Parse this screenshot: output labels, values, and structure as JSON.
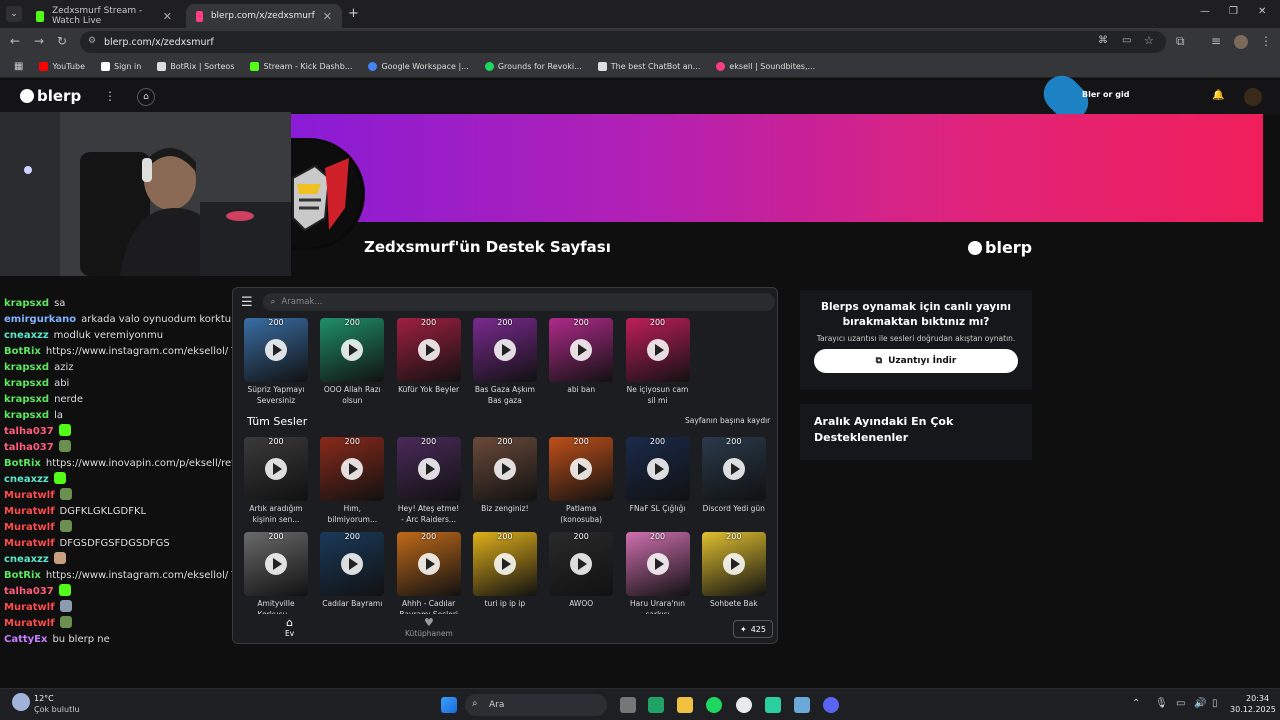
{
  "browser": {
    "tabs": [
      {
        "title": "Zedxsmurf Stream - Watch Live",
        "active": false,
        "color": "#53fc18"
      },
      {
        "title": "blerp.com/x/zedxsmurf",
        "active": true,
        "color": "#ff3d7f"
      }
    ],
    "url": "blerp.com/x/zedxsmurf",
    "bookmarks": [
      {
        "label": "YouTube",
        "color": "#ff0000"
      },
      {
        "label": "Sign in",
        "color": "#ffffff"
      },
      {
        "label": "BotRix | Sorteos",
        "color": "#dddddd"
      },
      {
        "label": "Stream - Kick Dashb...",
        "color": "#53fc18"
      },
      {
        "label": "Google Workspace |...",
        "color": "#4285f4"
      },
      {
        "label": "Grounds for Revoki...",
        "color": "#1ed760"
      },
      {
        "label": "The best ChatBot an...",
        "color": "#dddddd"
      },
      {
        "label": "eksell | Soundbites,...",
        "color": "#ff3d7f"
      }
    ]
  },
  "blerp": {
    "logo": "blerp",
    "page_title": "Zedxsmurf'ün Destek Sayfası",
    "header_right": "Bler   or   gid"
  },
  "chat": [
    {
      "user": "krapsxd",
      "color": "#5ee65e",
      "text": "sa"
    },
    {
      "user": "emirgurkano",
      "color": "#7fb2ff",
      "text": "arkada valo oynuodum korktum"
    },
    {
      "user": "cneaxzz",
      "color": "#5ee6c8",
      "text": "modluk veremiyonmu"
    },
    {
      "user": "BotRix",
      "color": "#5ee65e",
      "text": "https://www.instagram.com/eksellol/ Takip etmeyi unutma"
    },
    {
      "user": "krapsxd",
      "color": "#5ee65e",
      "text": "aziz"
    },
    {
      "user": "krapsxd",
      "color": "#5ee65e",
      "text": "abi"
    },
    {
      "user": "krapsxd",
      "color": "#5ee65e",
      "text": "nerde"
    },
    {
      "user": "krapsxd",
      "color": "#5ee65e",
      "text": "la"
    },
    {
      "user": "talha037",
      "color": "#ff5e7a",
      "text": "",
      "emote": "#53fc18"
    },
    {
      "user": "talha037",
      "color": "#ff5e7a",
      "text": "",
      "emote": "#6b8f4e"
    },
    {
      "user": "BotRix",
      "color": "#5ee65e",
      "text": "https://www.inovapin.com/p/eksell/ref Ucuz Pin için tıkla"
    },
    {
      "user": "cneaxzz",
      "color": "#5ee6c8",
      "text": "",
      "emote": "#53fc18"
    },
    {
      "user": "Muratwlf",
      "color": "#ff4b4b",
      "text": "",
      "emote": "#6b8f4e"
    },
    {
      "user": "Muratwlf",
      "color": "#ff4b4b",
      "text": "DGFKLGKLGDFKL"
    },
    {
      "user": "Muratwlf",
      "color": "#ff4b4b",
      "text": "",
      "emote": "#6b8f4e"
    },
    {
      "user": "Muratwlf",
      "color": "#ff4b4b",
      "text": "DFGSDFGSFDGSDFGS"
    },
    {
      "user": "cneaxzz",
      "color": "#5ee6c8",
      "text": "",
      "emote": "#c8a080"
    },
    {
      "user": "BotRix",
      "color": "#5ee65e",
      "text": "https://www.instagram.com/eksellol/ Takip etmeyi unutma"
    },
    {
      "user": "talha037",
      "color": "#ff5e7a",
      "text": "",
      "emote": "#53fc18"
    },
    {
      "user": "Muratwlf",
      "color": "#ff4b4b",
      "text": "",
      "emote": "#8d9bb0"
    },
    {
      "user": "Muratwlf",
      "color": "#ff4b4b",
      "text": "",
      "emote": "#6b8f4e"
    },
    {
      "user": "CattyEx",
      "color": "#c77dff",
      "text": "bu blerp ne"
    }
  ],
  "panel": {
    "search_placeholder": "Aramak...",
    "section_title": "Tüm Sesler",
    "scroll_top": "Sayfanın başına kaydır",
    "featured": [
      {
        "count": "200",
        "label": "Süpriz Yapmayı Seversiniz",
        "color": "#3a6ea5"
      },
      {
        "count": "200",
        "label": "OOO Allah Razı olsun",
        "color": "#1f8f6a"
      },
      {
        "count": "200",
        "label": "Küfür Yok Beyler",
        "color": "#a02040"
      },
      {
        "count": "200",
        "label": "Bas Gaza Aşkım Bas gaza",
        "color": "#7a2a90"
      },
      {
        "count": "200",
        "label": "abi ban",
        "color": "#b02a8a"
      },
      {
        "count": "200",
        "label": "Ne içiyosun cam sil mi",
        "color": "#c01e5a"
      }
    ],
    "row1": [
      {
        "count": "200",
        "label": "Artık aradığım kişinin sen...",
        "color": "#3a3a3a"
      },
      {
        "count": "200",
        "label": "Hım, bilmiyorum...",
        "color": "#8a2a1a"
      },
      {
        "count": "200",
        "label": "Hey! Ateş etme! - Arc Raiders...",
        "color": "#4a2a5a"
      },
      {
        "count": "200",
        "label": "Biz zenginiz!",
        "color": "#6a4a3a"
      },
      {
        "count": "200",
        "label": "Patlama (konosuba)",
        "color": "#c0501a"
      },
      {
        "count": "200",
        "label": "FNaF SL Çığlığı",
        "color": "#1a2a4a"
      },
      {
        "count": "200",
        "label": "Discord Yedi gün",
        "color": "#2a3a4a"
      }
    ],
    "row2": [
      {
        "count": "200",
        "label": "Amityville Korkusu...",
        "color": "#6a6a6a"
      },
      {
        "count": "200",
        "label": "Cadılar Bayramı",
        "color": "#1a3a5a"
      },
      {
        "count": "200",
        "label": "Ahhh - Cadılar Bayramı Sesleri",
        "color": "#c06a1a"
      },
      {
        "count": "200",
        "label": "turi ip ip ip",
        "color": "#e0b01a"
      },
      {
        "count": "200",
        "label": "AWOO",
        "color": "#2a2a2a"
      },
      {
        "count": "200",
        "label": "Haru Urara'nın şarkısı",
        "color": "#d070b0"
      },
      {
        "count": "200",
        "label": "Sohbete Bak",
        "color": "#e0c030"
      }
    ],
    "nav_home": "Ev",
    "nav_library": "Kütüphanem",
    "coins": "425"
  },
  "promo": {
    "heading": "Blerps oynamak için canlı yayını bırakmaktan bıktınız mı?",
    "sub": "Tarayıcı uzantısı ile sesleri doğrudan akıştan oynatın.",
    "button": "Uzantıyı İndir"
  },
  "top_supporters": "Aralık Ayındaki En Çok Desteklenenler",
  "taskbar": {
    "weather_temp": "12°C",
    "weather_desc": "Çok bulutlu",
    "search": "Ara",
    "time": "20:34",
    "date": "30.12.2025"
  }
}
